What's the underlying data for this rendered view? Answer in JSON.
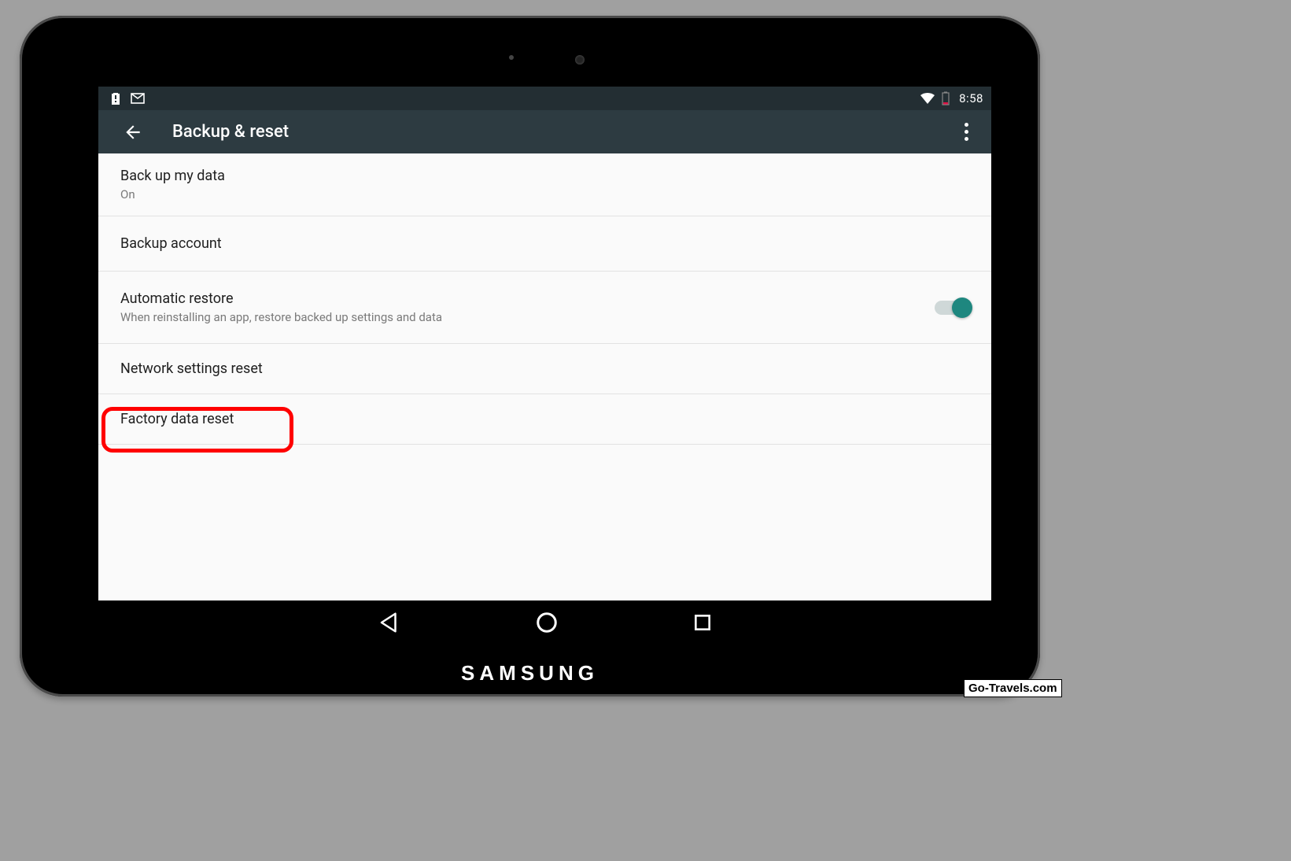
{
  "statusbar": {
    "time": "8:58"
  },
  "appbar": {
    "title": "Backup & reset"
  },
  "items": {
    "backup_my_data": {
      "title": "Back up my data",
      "subtitle": "On"
    },
    "backup_account": {
      "title": "Backup account"
    },
    "automatic_restore": {
      "title": "Automatic restore",
      "subtitle": "When reinstalling an app, restore backed up settings and data",
      "toggle": true
    },
    "network_reset": {
      "title": "Network settings reset"
    },
    "factory_reset": {
      "title": "Factory data reset"
    }
  },
  "brand": "SAMSUNG",
  "watermark": "Go-Travels.com"
}
